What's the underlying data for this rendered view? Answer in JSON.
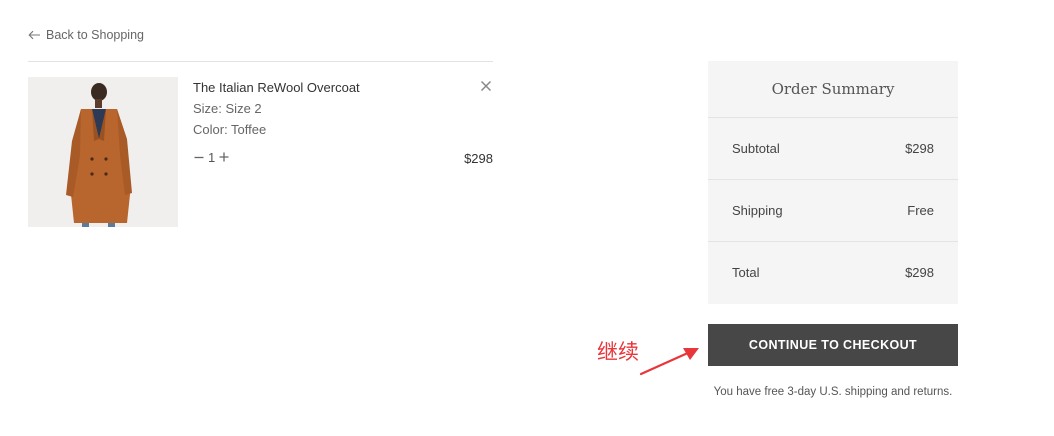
{
  "nav": {
    "back_label": "Back to Shopping"
  },
  "cart_item": {
    "name": "The Italian ReWool Overcoat",
    "size": "Size: Size 2",
    "color": "Color: Toffee",
    "quantity": "1",
    "price": "$298",
    "image_icon": "overcoat-photo"
  },
  "summary": {
    "title": "Order Summary",
    "rows": [
      {
        "label": "Subtotal",
        "value": "$298"
      },
      {
        "label": "Shipping",
        "value": "Free"
      },
      {
        "label": "Total",
        "value": "$298"
      }
    ]
  },
  "checkout": {
    "button_label": "CONTINUE TO CHECKOUT",
    "note": "You have free 3-day U.S. shipping and returns."
  },
  "annotation": {
    "text": "继续",
    "color": "#e8363a"
  },
  "colors": {
    "button": "#474747",
    "summary_bg": "#f5f5f5",
    "coat": "#b8662e"
  }
}
